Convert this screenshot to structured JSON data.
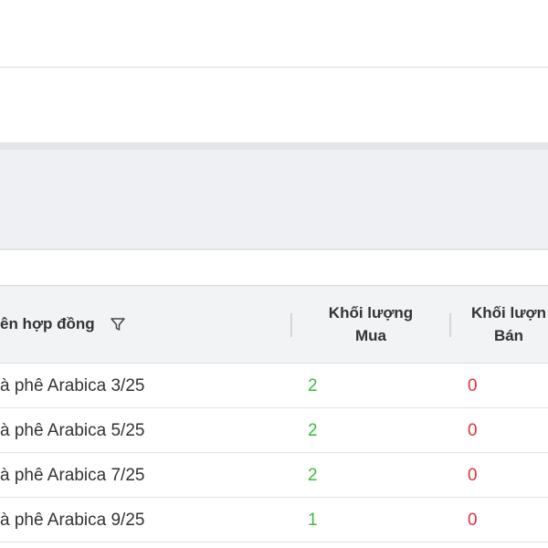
{
  "table": {
    "columns": {
      "name": "ên hợp đồng",
      "buy_line1": "Khối lượng",
      "buy_line2": "Mua",
      "sell_line1": "Khối lượn",
      "sell_line2": "Bán"
    },
    "rows": [
      {
        "name": "à phê Arabica 3/25",
        "buy": "2",
        "sell": "0"
      },
      {
        "name": "à phê Arabica 5/25",
        "buy": "2",
        "sell": "0"
      },
      {
        "name": "à phê Arabica 7/25",
        "buy": "2",
        "sell": "0"
      },
      {
        "name": "à phê Arabica 9/25",
        "buy": "1",
        "sell": "0"
      }
    ]
  },
  "colors": {
    "buy": "#3dbb3d",
    "sell": "#e8323c",
    "header_bg": "#f2f3f5",
    "band_bg": "#eef0f3"
  },
  "icons": {
    "name_column_filter": "filter-icon"
  }
}
